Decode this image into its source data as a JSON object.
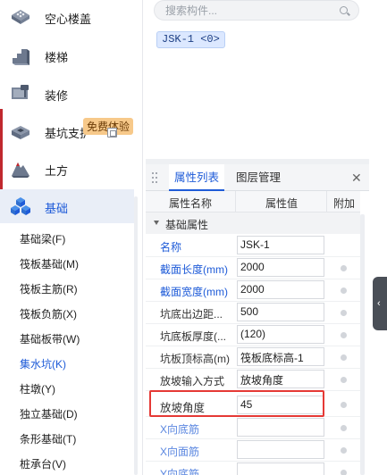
{
  "nav": {
    "categories": [
      {
        "label": "空心楼盖",
        "icon": "hollow-floor-icon"
      },
      {
        "label": "楼梯",
        "icon": "stairs-icon"
      },
      {
        "label": "装修",
        "icon": "decoration-icon"
      },
      {
        "label": "基坑支护",
        "icon": "foundation-pit-icon",
        "badge": "免费体验"
      },
      {
        "label": "土方",
        "icon": "earthwork-icon"
      },
      {
        "label": "基础",
        "icon": "foundation-icon",
        "active": true
      }
    ],
    "sub_items": [
      {
        "label": "基础梁(F)"
      },
      {
        "label": "筏板基础(M)"
      },
      {
        "label": "筏板主筋(R)"
      },
      {
        "label": "筏板负筋(X)"
      },
      {
        "label": "基础板带(W)"
      },
      {
        "label": "集水坑(K)",
        "active": true
      },
      {
        "label": "柱墩(Y)"
      },
      {
        "label": "独立基础(D)"
      },
      {
        "label": "条形基础(T)"
      },
      {
        "label": "桩承台(V)"
      }
    ],
    "active_color": "#1e5bd8"
  },
  "component_list": {
    "search_placeholder": "搜索构件...",
    "selected_item": "JSK-1 <0>"
  },
  "property_panel": {
    "tabs": [
      "属性列表",
      "图层管理"
    ],
    "active_tab": "属性列表",
    "columns": [
      "属性名称",
      "属性值",
      "附加"
    ],
    "group_title": "基础属性",
    "rows": [
      {
        "name": "名称",
        "value": "JSK-1",
        "name_color": "blue",
        "has_dot": false
      },
      {
        "name": "截面长度(mm)",
        "value": "2000",
        "name_color": "blue",
        "has_dot": true
      },
      {
        "name": "截面宽度(mm)",
        "value": "2000",
        "name_color": "blue",
        "has_dot": true
      },
      {
        "name": "坑底出边距...",
        "value": "500",
        "name_color": "black",
        "has_dot": true
      },
      {
        "name": "坑底板厚度(...",
        "value": "(120)",
        "name_color": "black",
        "has_dot": true
      },
      {
        "name": "坑板顶标高(m)",
        "value": "筏板底标高-1",
        "name_color": "black",
        "has_dot": true
      },
      {
        "name": "放坡输入方式",
        "value": "放坡角度",
        "name_color": "black",
        "has_dot": true
      },
      {
        "name": "放坡角度",
        "value": "45",
        "name_color": "black",
        "has_dot": true,
        "highlighted": true
      },
      {
        "name": "X向底筋",
        "value": "",
        "name_color": "lightblue",
        "has_dot": true
      },
      {
        "name": "X向面筋",
        "value": "",
        "name_color": "lightblue",
        "has_dot": true
      },
      {
        "name": "Y向底筋",
        "value": "",
        "name_color": "lightblue",
        "has_dot": true
      }
    ],
    "highlight_color": "#e53935"
  }
}
